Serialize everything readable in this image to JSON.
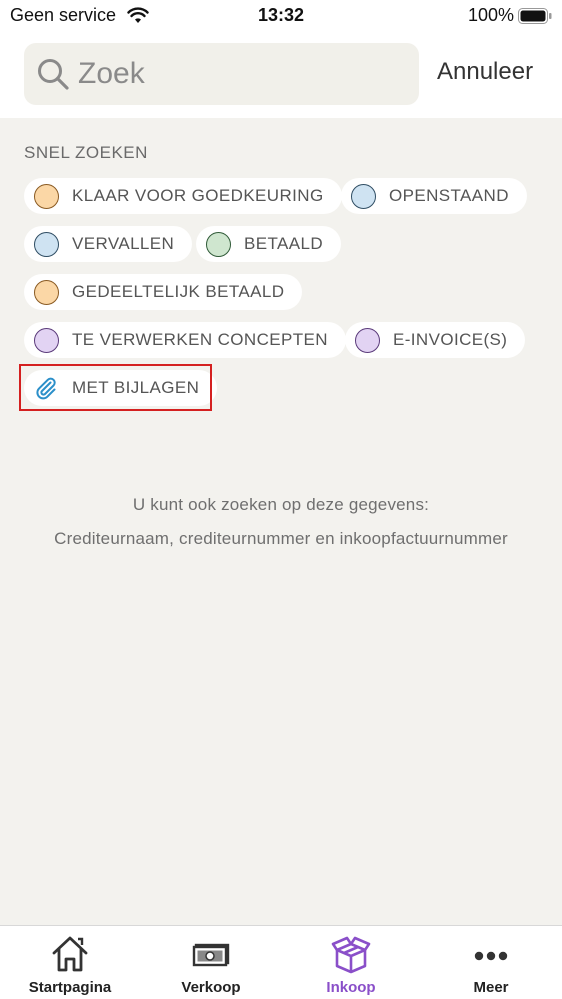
{
  "status_bar": {
    "carrier": "Geen service",
    "time": "13:32",
    "battery": "100%"
  },
  "search": {
    "placeholder": "Zoek",
    "value": "",
    "cancel_label": "Annuleer"
  },
  "quick_search": {
    "title": "SNEL ZOEKEN",
    "chips": [
      {
        "label": "KLAAR VOOR GOEDKEURING",
        "color": "#fbd7a6"
      },
      {
        "label": "OPENSTAAND",
        "color": "#cfe3f2"
      },
      {
        "label": "VERVALLEN",
        "color": "#cfe3f2"
      },
      {
        "label": "BETAALD",
        "color": "#cfe6cf"
      },
      {
        "label": "GEDEELTELIJK BETAALD",
        "color": "#fbd7a6"
      },
      {
        "label": "TE VERWERKEN CONCEPTEN",
        "color": "#e2d3f3"
      },
      {
        "label": "E-INVOICE(S)",
        "color": "#e2d3f3"
      },
      {
        "label": "MET BIJLAGEN",
        "icon": "paperclip-icon"
      }
    ]
  },
  "hint": {
    "line1": "U kunt ook zoeken op deze gegevens:",
    "line2": "Crediteurnaam, crediteurnummer en inkoopfactuurnummer"
  },
  "tab_bar": {
    "items": [
      {
        "label": "Startpagina",
        "icon": "home-icon"
      },
      {
        "label": "Verkoop",
        "icon": "banknote-icon"
      },
      {
        "label": "Inkoop",
        "icon": "box-icon",
        "active": true
      },
      {
        "label": "Meer",
        "icon": "more-icon"
      }
    ],
    "active_color": "#8a4fc9"
  }
}
